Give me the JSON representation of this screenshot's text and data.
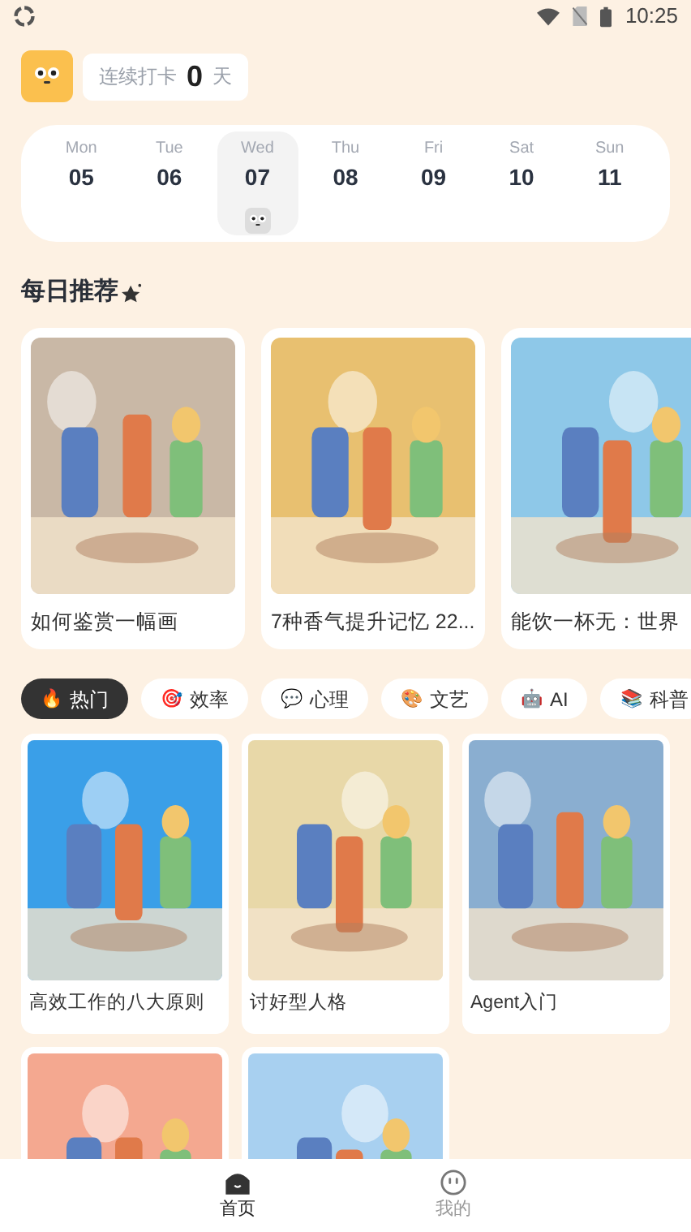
{
  "status_bar": {
    "time": "10:25"
  },
  "header": {
    "streak_label": "连续打卡",
    "streak_count": "0",
    "streak_unit": "天"
  },
  "week": [
    {
      "day": "Mon",
      "date": "05",
      "selected": false
    },
    {
      "day": "Tue",
      "date": "06",
      "selected": false
    },
    {
      "day": "Wed",
      "date": "07",
      "selected": true
    },
    {
      "day": "Thu",
      "date": "08",
      "selected": false
    },
    {
      "day": "Fri",
      "date": "09",
      "selected": false
    },
    {
      "day": "Sat",
      "date": "10",
      "selected": false
    },
    {
      "day": "Sun",
      "date": "11",
      "selected": false
    }
  ],
  "daily": {
    "title": "每日推荐",
    "cards": [
      {
        "title": "如何鉴赏一幅画",
        "color": "#c9b8a6"
      },
      {
        "title": "7种香气提升记忆 22...",
        "color": "#e8c070"
      },
      {
        "title": "能饮一杯无：世界",
        "color": "#8ec8e8"
      }
    ]
  },
  "categories": [
    {
      "icon": "🔥",
      "label": "热门",
      "selected": true
    },
    {
      "icon": "🎯",
      "label": "效率",
      "selected": false
    },
    {
      "icon": "💬",
      "label": "心理",
      "selected": false
    },
    {
      "icon": "🎨",
      "label": "文艺",
      "selected": false
    },
    {
      "icon": "🤖",
      "label": "AI",
      "selected": false
    },
    {
      "icon": "📚",
      "label": "科普",
      "selected": false
    }
  ],
  "articles": [
    {
      "title": "高效工作的八大原则",
      "color": "#3a9fe8"
    },
    {
      "title": "讨好型人格",
      "color": "#e8d8a8"
    },
    {
      "title": "Agent入门",
      "color": "#8aaed0"
    },
    {
      "color": "#f4a890"
    },
    {
      "color": "#a8d0f0"
    }
  ],
  "tabs": [
    {
      "label": "首页",
      "selected": true
    },
    {
      "label": "我的",
      "selected": false
    }
  ]
}
